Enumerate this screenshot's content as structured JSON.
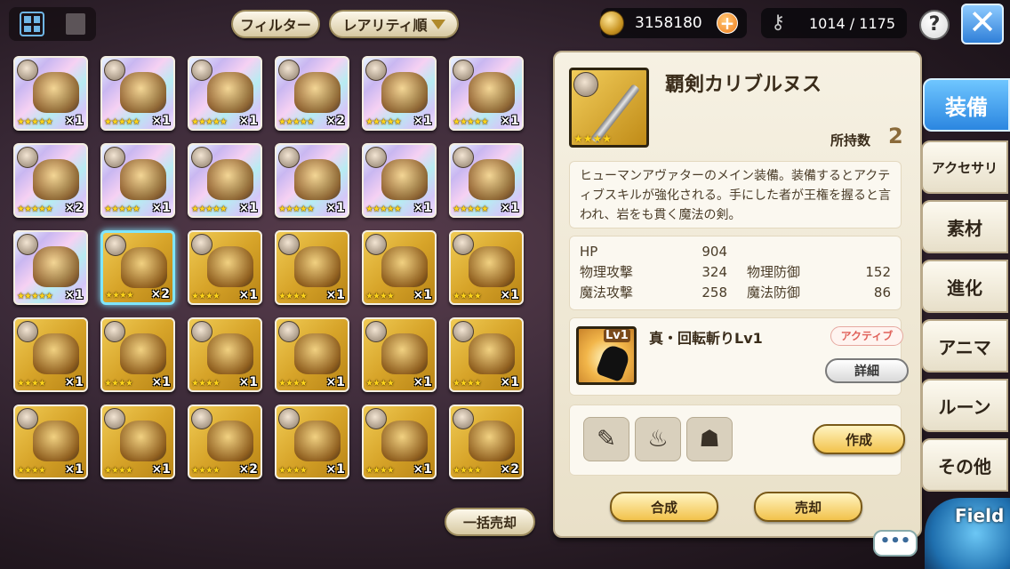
{
  "top": {
    "filter_label": "フィルター",
    "sort_label": "レアリティ順",
    "gold": "3158180",
    "capacity": "1014 / 1175",
    "help_label": "?"
  },
  "items": [
    {
      "bg": "rainbow",
      "stars": "★★★★★",
      "count": "×1"
    },
    {
      "bg": "rainbow",
      "stars": "★★★★★",
      "count": "×1"
    },
    {
      "bg": "rainbow",
      "stars": "★★★★★",
      "count": "×1"
    },
    {
      "bg": "rainbow",
      "stars": "★★★★★",
      "count": "×2"
    },
    {
      "bg": "rainbow",
      "stars": "★★★★★",
      "count": "×1"
    },
    {
      "bg": "rainbow",
      "stars": "★★★★★",
      "count": "×1"
    },
    {
      "bg": "rainbow",
      "stars": "★★★★★",
      "count": "×2"
    },
    {
      "bg": "rainbow",
      "stars": "★★★★★",
      "count": "×1"
    },
    {
      "bg": "rainbow",
      "stars": "★★★★★",
      "count": "×1"
    },
    {
      "bg": "rainbow",
      "stars": "★★★★★",
      "count": "×1"
    },
    {
      "bg": "rainbow",
      "stars": "★★★★★",
      "count": "×1"
    },
    {
      "bg": "rainbow",
      "stars": "★★★★★",
      "count": "×1"
    },
    {
      "bg": "rainbow",
      "stars": "★★★★★",
      "count": "×1"
    },
    {
      "bg": "gold",
      "stars": "★★★★",
      "count": "×2",
      "selected": true
    },
    {
      "bg": "gold",
      "stars": "★★★★",
      "count": "×1"
    },
    {
      "bg": "gold",
      "stars": "★★★★",
      "count": "×1"
    },
    {
      "bg": "gold",
      "stars": "★★★★",
      "count": "×1"
    },
    {
      "bg": "gold",
      "stars": "★★★★",
      "count": "×1"
    },
    {
      "bg": "gold",
      "stars": "★★★★",
      "count": "×1"
    },
    {
      "bg": "gold",
      "stars": "★★★★",
      "count": "×1"
    },
    {
      "bg": "gold",
      "stars": "★★★★",
      "count": "×1"
    },
    {
      "bg": "gold",
      "stars": "★★★★",
      "count": "×1"
    },
    {
      "bg": "gold",
      "stars": "★★★★",
      "count": "×1"
    },
    {
      "bg": "gold",
      "stars": "★★★★",
      "count": "×1"
    },
    {
      "bg": "gold",
      "stars": "★★★★",
      "count": "×1"
    },
    {
      "bg": "gold",
      "stars": "★★★★",
      "count": "×1"
    },
    {
      "bg": "gold",
      "stars": "★★★★",
      "count": "×2"
    },
    {
      "bg": "gold",
      "stars": "★★★★",
      "count": "×1"
    },
    {
      "bg": "gold",
      "stars": "★★★★",
      "count": "×1"
    },
    {
      "bg": "gold",
      "stars": "★★★★",
      "count": "×2"
    }
  ],
  "bulk_sell_label": "一括売却",
  "detail": {
    "name": "覇剣カリブルヌス",
    "stars": "★★★★",
    "owned_label": "所持数",
    "owned_count": "2",
    "description": "ヒューマンアヴァターのメイン装備。装備するとアクティブスキルが強化される。手にした者が王権を握ると言われ、岩をも貫く魔法の剣。",
    "stats": {
      "hp_label": "HP",
      "hp": "904",
      "patk_label": "物理攻撃",
      "patk": "324",
      "pdef_label": "物理防御",
      "pdef": "152",
      "matk_label": "魔法攻撃",
      "matk": "258",
      "mdef_label": "魔法防御",
      "mdef": "86"
    },
    "skill": {
      "level_badge": "Lv1",
      "name": "真・回転斬りLv1",
      "type": "アクティブ",
      "detail_label": "詳細"
    },
    "craft_label": "作成",
    "fuse_label": "合成",
    "sell_label": "売却"
  },
  "tabs": [
    "装備",
    "アクセサリ",
    "素材",
    "進化",
    "アニマ",
    "ルーン",
    "その他"
  ],
  "chat_label": "•••",
  "field_label": "Field"
}
